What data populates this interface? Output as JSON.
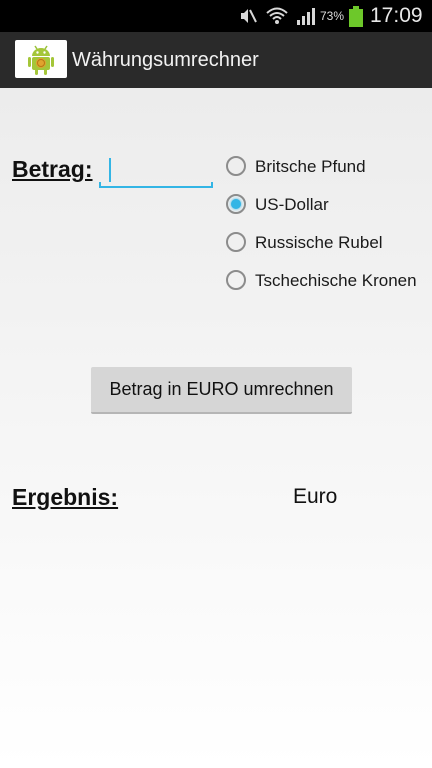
{
  "status_bar": {
    "icons": [
      "mute-icon",
      "wifi-icon",
      "signal-icon",
      "battery-icon"
    ],
    "battery_percent": "73%",
    "time": "17:09",
    "colors": {
      "background": "#000000",
      "battery": "#6dc82a"
    }
  },
  "action_bar": {
    "app_icon": "android-icon",
    "title": "Währungsumrechner",
    "background": "#2a2a2a"
  },
  "form": {
    "amount_label": "Betrag:",
    "amount_value": "",
    "accent_color": "#33b5e5",
    "currencies": [
      {
        "label": "Britsche Pfund",
        "checked": false
      },
      {
        "label": "US-Dollar",
        "checked": true
      },
      {
        "label": "Russische Rubel",
        "checked": false
      },
      {
        "label": "Tschechische Kronen",
        "checked": false
      }
    ],
    "convert_button": "Betrag in EURO umrechnen"
  },
  "result": {
    "label": "Ergebnis:",
    "currency": "Euro"
  }
}
